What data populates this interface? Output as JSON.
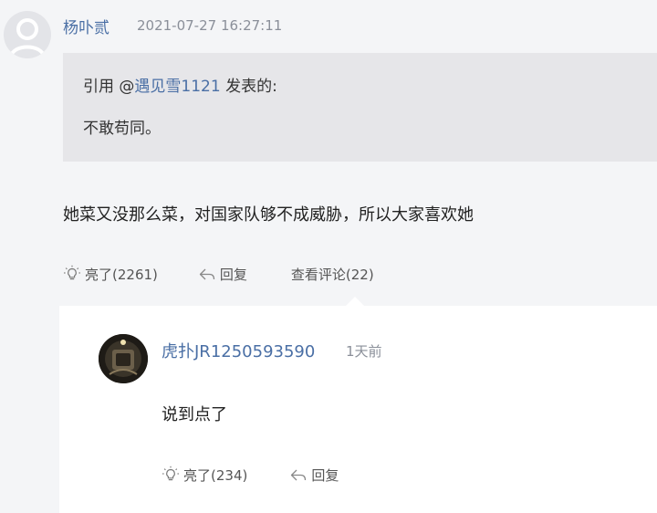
{
  "post": {
    "author": "杨卟贰",
    "time": "2021-07-27 16:27:11",
    "quote": {
      "prefix": "引用 @",
      "mention": "遇见雪1121",
      "suffix": " 发表的:",
      "text": "不敢苟同。"
    },
    "body": "她菜又没那么菜，对国家队够不成威胁，所以大家喜欢她",
    "actions": {
      "like": "亮了(2261)",
      "reply": "回复",
      "view_comments": "查看评论(22)"
    }
  },
  "comment": {
    "author": "虎扑JR1250593590",
    "time": "1天前",
    "body": "说到点了",
    "actions": {
      "like": "亮了(234)",
      "reply": "回复"
    }
  },
  "icons": {
    "like": "lightbulb-icon",
    "reply": "reply-arrow-icon",
    "default_avatar": "default-avatar-icon"
  },
  "colors": {
    "username": "#4a6fa5",
    "muted": "#8a8f99",
    "quote_bg": "#e6e6e9",
    "page_bg": "#f4f5f7"
  }
}
